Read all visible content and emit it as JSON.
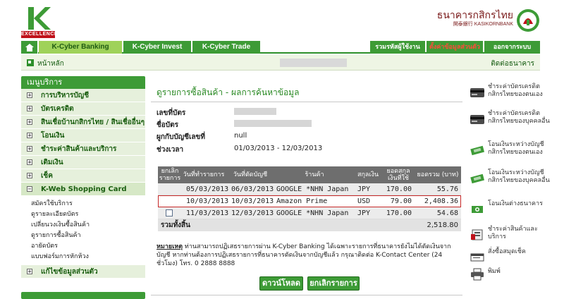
{
  "header": {
    "logo_band": "EXCELLENCE",
    "bank_name_th": "ธนาคารกสิกรไทย",
    "bank_name_en": "開泰銀行 KASIKORNBANK"
  },
  "nav": {
    "tabs": [
      "K-Cyber Banking",
      "K-Cyber Invest",
      "K-Cyber Trade"
    ],
    "right_tabs": [
      "รวมรหัสผู้ใช้งาน",
      "ตั้งค่าข้อมูลส่วนตัว",
      "ออกจากระบบ"
    ]
  },
  "breadcrumb": {
    "home": "หน้าหลัก",
    "contact": "ติดต่อธนาคาร"
  },
  "left_menu": {
    "title": "เมนูบริการ",
    "items": [
      {
        "label": "การบริหารบัญชี",
        "mark": "+"
      },
      {
        "label": "บัตรเครดิต",
        "mark": "+"
      },
      {
        "label": "สินเชื่อบ้านกสิกรไทย / สินเชื่ออื่นๆ",
        "mark": "+"
      },
      {
        "label": "โอนเงิน",
        "mark": "+"
      },
      {
        "label": "ชำระค่าสินค้าและบริการ",
        "mark": "+"
      },
      {
        "label": "เติมเงิน",
        "mark": "+"
      },
      {
        "label": "เช็ค",
        "mark": "+"
      },
      {
        "label": "K-Web Shopping Card",
        "mark": "−"
      }
    ],
    "subitems": [
      "สมัครใช้บริการ",
      "ดูรายละเอียดบัตร",
      "เปลี่ยนวงเงินซื้อสินค้า",
      "ดูรายการซื้อสินค้า",
      "อายัดบัตร",
      "แบบฟอร์มการหักห้วง"
    ],
    "last_item": {
      "label": "แก้ไขข้อมูลส่วนตัว",
      "mark": "+"
    }
  },
  "main": {
    "title": "ดูรายการซื้อสินค้า - ผลการค้นหาข้อมูล",
    "info": [
      {
        "label": "เลขที่บัตร",
        "value": ""
      },
      {
        "label": "ชื่อบัตร",
        "value": ""
      },
      {
        "label": "ผูกกับบัญชีเลขที่",
        "value": "null"
      },
      {
        "label": "ช่วงเวลา",
        "value": "01/03/2013 - 12/03/2013"
      }
    ],
    "table": {
      "headers": [
        "ยกเลิกรายการ",
        "วันที่ทำรายการ",
        "วันที่ตัดบัญชี",
        "ร้านค้า",
        "สกุลเงิน",
        "ยอดสกุลเงินที่ใช้",
        "ยอดรวม (บาท)"
      ],
      "rows": [
        {
          "cancel": "",
          "txn_date": "05/03/2013",
          "post_date": "06/03/2013",
          "merchant": "GOOGLE *NHN Japan",
          "currency": "JPY",
          "amount": "170.00",
          "total": "55.76"
        },
        {
          "cancel": "",
          "txn_date": "10/03/2013",
          "post_date": "10/03/2013",
          "merchant": "Amazon Prime",
          "currency": "USD",
          "amount": "79.00",
          "total": "2,408.36"
        },
        {
          "cancel": "checkbox",
          "txn_date": "11/03/2013",
          "post_date": "12/03/2013",
          "merchant": "GOOGLE *NHN Japan",
          "currency": "JPY",
          "amount": "170.00",
          "total": "54.68"
        }
      ],
      "total_label": "รวมทั้งสิ้น",
      "total_value": "2,518.80"
    },
    "note_label": "หมายเหตุ",
    "note_text": " ท่านสามารถปฏิเสธรายการผ่าน K-Cyber Banking ได้เฉพาะรายการที่ธนาคารยังไม่ได้ตัดเงินจากบัญชี หากท่านต้องการปฏิเสธรายการที่ธนาคารตัดเงินจากบัญชีแล้ว กรุณาติดต่อ K-Contact Center (24 ชั่วโมง) โทร. 0 2888 8888",
    "buttons": {
      "download": "ดาวน์โหลด",
      "cancel": "ยกเลิกรายการ"
    }
  },
  "right_menu": [
    {
      "label": "ชำระค่าบัตรเครดิตกสิกรไทยของตนเอง",
      "icon": "credit-card-icon"
    },
    {
      "label": "ชำระค่าบัตรเครดิตกสิกรไทยของบุคคลอื่น",
      "icon": "credit-card-icon"
    },
    {
      "label": "โอนเงินระหว่างบัญชีกสิกรไทยของตนเอง",
      "icon": "transfer-icon"
    },
    {
      "label": "โอนเงินระหว่างบัญชีกสิกรไทยของบุคคลอื่น",
      "icon": "transfer-icon"
    },
    {
      "label": "โอนเงินต่างธนาคาร",
      "icon": "bank-transfer-icon"
    },
    {
      "label": "ชำระค่าสินค้าและบริการ",
      "icon": "payment-icon"
    },
    {
      "label": "สั่งซื้อสมุดเช็ค",
      "icon": "cheque-book-icon"
    },
    {
      "label": "พิมพ์",
      "icon": "printer-icon"
    }
  ],
  "colors": {
    "brand_green": "#3d9b36",
    "light_green": "#9fd25a",
    "highlight_red": "#c62828",
    "header_grey": "#6e6e6e"
  }
}
